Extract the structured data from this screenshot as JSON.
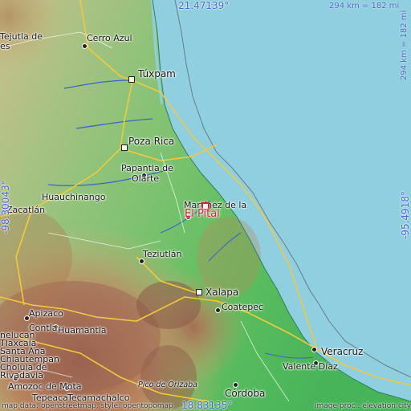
{
  "coordinates": {
    "top": "21.47139°",
    "bottom": "18.83135°",
    "left": "-98.30043°",
    "right": "-95.4918°"
  },
  "scale": {
    "horizontal": "294 km = 182 mi",
    "vertical": "294 km = 182 mi"
  },
  "target": {
    "name": "El Pital"
  },
  "places": {
    "tejutla": "Tejutla de",
    "es": "es",
    "cerro_azul": "Cerro Azul",
    "tuxpam": "Túxpam",
    "poza_rica": "Poza Rica",
    "papantla": "Papantla de",
    "olarte": "Olarte",
    "huauchinango": "Huauchinango",
    "zacatlan": "Zacatlán",
    "martinez": "Martínez de la",
    "teziutlan": "Teziutlán",
    "xalapa": "Xalapa",
    "coatepec": "Coatepec",
    "apizaco": "Apizaco",
    "contla": "Contla",
    "huamantla": "Huamantla",
    "nelucan": "nelucan",
    "tlaxcala": "Tlaxcala",
    "santa_ana": "Santa Ana",
    "chiautempan": "Chiautempan",
    "cholula": "Cholula de",
    "rivadavia": "Rivadavia",
    "amozoc": "Amozoc de Mota",
    "tepeaca": "Tepeaca",
    "tecamachalco": "Tecamachalco",
    "pico": "Pico de Orizaba",
    "cordoba": "Córdoba",
    "veracruz": "Veracruz",
    "valente": "Valente Díaz"
  },
  "credits": {
    "left": "map data: openstreetmap, style: opentopomap",
    "right": "image proc.: elevation.city"
  },
  "colors": {
    "sea": "#8fcfe0",
    "target": "#d81b3a",
    "coord_text": "#4a66c8"
  }
}
